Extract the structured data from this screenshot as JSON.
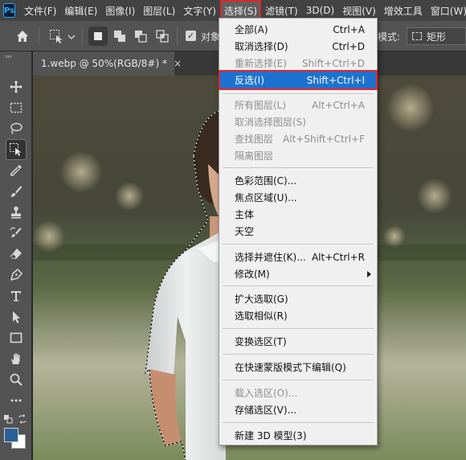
{
  "app": {
    "logo": "Ps"
  },
  "menubar": {
    "items": [
      "文件(F)",
      "编辑(E)",
      "图像(I)",
      "图层(L)",
      "文字(Y)",
      "选择(S)",
      "滤镜(T)",
      "3D(D)",
      "视图(V)",
      "增效工具",
      "窗口(W)"
    ],
    "active_index": 5
  },
  "options_bar": {
    "antialias_checked": true,
    "antialias_label": "对象",
    "mode_label": "模式:",
    "shape_value": "矩形"
  },
  "document": {
    "tab_title": "1.webp @ 50%(RGB/8#) *",
    "close_glyph": "×"
  },
  "colors": {
    "foreground": "#2a6099",
    "background": "#ffffff",
    "highlight_outline": "#e1262b",
    "menu_highlight": "#1e72cf"
  },
  "select_menu": {
    "items": [
      {
        "label": "全部(A)",
        "shortcut": "Ctrl+A",
        "disabled": false
      },
      {
        "label": "取消选择(D)",
        "shortcut": "Ctrl+D",
        "disabled": false
      },
      {
        "label": "重新选择(E)",
        "shortcut": "Shift+Ctrl+D",
        "disabled": true
      },
      {
        "label": "反选(I)",
        "shortcut": "Shift+Ctrl+I",
        "disabled": false,
        "highlighted": true
      },
      {
        "label": "所有图层(L)",
        "shortcut": "Alt+Ctrl+A",
        "disabled": true
      },
      {
        "label": "取消选择图层(S)",
        "shortcut": "",
        "disabled": true
      },
      {
        "label": "查找图层",
        "shortcut": "Alt+Shift+Ctrl+F",
        "disabled": true
      },
      {
        "label": "隔离图层",
        "shortcut": "",
        "disabled": true
      },
      {
        "label": "色彩范围(C)...",
        "shortcut": "",
        "disabled": false
      },
      {
        "label": "焦点区域(U)...",
        "shortcut": "",
        "disabled": false
      },
      {
        "label": "主体",
        "shortcut": "",
        "disabled": false
      },
      {
        "label": "天空",
        "shortcut": "",
        "disabled": false
      },
      {
        "label": "选择并遮住(K)...",
        "shortcut": "Alt+Ctrl+R",
        "disabled": false
      },
      {
        "label": "修改(M)",
        "shortcut": "",
        "disabled": false,
        "submenu": true
      },
      {
        "label": "扩大选取(G)",
        "shortcut": "",
        "disabled": false
      },
      {
        "label": "选取相似(R)",
        "shortcut": "",
        "disabled": false
      },
      {
        "label": "变换选区(T)",
        "shortcut": "",
        "disabled": false
      },
      {
        "label": "在快速蒙版模式下编辑(Q)",
        "shortcut": "",
        "disabled": false
      },
      {
        "label": "载入选区(O)...",
        "shortcut": "",
        "disabled": true
      },
      {
        "label": "存储选区(V)...",
        "shortcut": "",
        "disabled": false
      },
      {
        "label": "新建 3D 模型(3)",
        "shortcut": "",
        "disabled": false
      }
    ]
  },
  "tools": [
    "move-tool",
    "rectangular-marquee-tool",
    "lasso-tool",
    "object-selection-tool",
    "eyedropper-tool",
    "brush-tool",
    "clone-stamp-tool",
    "history-brush-tool",
    "eraser-tool",
    "pen-tool",
    "type-tool",
    "path-selection-tool",
    "rectangle-tool",
    "hand-tool",
    "zoom-tool",
    "more-tools"
  ]
}
